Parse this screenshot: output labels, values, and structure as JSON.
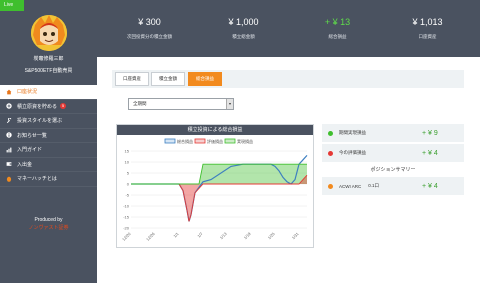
{
  "live_badge": "Live",
  "user": {
    "name": "炭竈修羅三郎",
    "subtitle": "S&P500ETF自動売買"
  },
  "nav": [
    {
      "label": "口座状況",
      "icon": "home-icon"
    },
    {
      "label": "積立原資を貯める",
      "icon": "plus-icon",
      "badge": "5"
    },
    {
      "label": "投資スタイルを選ぶ",
      "icon": "wrench-icon"
    },
    {
      "label": "お知らせ一覧",
      "icon": "info-icon"
    },
    {
      "label": "入門ガイド",
      "icon": "chart-icon"
    },
    {
      "label": "入出金",
      "icon": "wallet-icon"
    },
    {
      "label": "マネーハッチとは",
      "icon": "egg-icon"
    }
  ],
  "footer": {
    "produced": "Produced by",
    "brand": "ノンヴァスト証券"
  },
  "stats": [
    {
      "value": "¥ 300",
      "label": "次回投資分の積立金額",
      "color": "white"
    },
    {
      "value": "¥ 1,000",
      "label": "積立総金額",
      "color": "white"
    },
    {
      "value": "+ ¥ 13",
      "label": "総合損益",
      "color": "green"
    },
    {
      "value": "¥ 1,013",
      "label": "口座資産",
      "color": "white"
    }
  ],
  "tabs": [
    {
      "label": "口座資産",
      "active": false
    },
    {
      "label": "積立金額",
      "active": false
    },
    {
      "label": "総合損益",
      "active": true
    }
  ],
  "period_select": {
    "value": "全期間"
  },
  "chart": {
    "header": "積立投資による総合損益",
    "legend": [
      "総合損益",
      "評価損益",
      "実現損益"
    ]
  },
  "summary": {
    "rows": [
      {
        "label": "期間実現損益",
        "amount": "+ ¥ 9",
        "color": "#3fbf2e"
      },
      {
        "label": "今の評価損益",
        "amount": "+ ¥ 4",
        "color": "#e53935"
      }
    ],
    "positions_title": "ポジションサマリー",
    "positions": [
      {
        "name": "ACWI ARC",
        "qty": "0.1口",
        "amount": "+ ¥ 4",
        "color": "#f28a1e"
      }
    ]
  },
  "chart_data": {
    "type": "line",
    "title": "積立投資による総合損益",
    "x_ticks": [
      "12/20",
      "12/26",
      "1/1",
      "1/7",
      "1/13",
      "1/19",
      "1/25",
      "1/31"
    ],
    "ylim": [
      -20,
      15
    ],
    "y_ticks": [
      15,
      10,
      5,
      0,
      -5,
      -10,
      -15,
      -20
    ],
    "series": [
      {
        "name": "総合損益",
        "color": "#3d7fc0",
        "x": [
          0,
          5,
          10,
          12,
          13,
          14,
          14.5,
          15,
          16,
          18,
          20,
          25,
          28,
          30,
          31,
          32,
          33,
          34,
          35,
          36,
          37,
          38,
          39,
          40,
          41,
          42,
          43,
          44
        ],
        "y": [
          0,
          0,
          0,
          0,
          -3,
          -12,
          -17,
          -14,
          -4,
          1,
          2,
          8,
          9,
          9,
          9,
          9,
          9,
          9,
          9,
          8,
          6,
          3,
          1,
          0,
          2,
          9,
          11,
          13
        ]
      },
      {
        "name": "評価損益",
        "color": "#e53935",
        "x": [
          0,
          5,
          10,
          12,
          13,
          14,
          14.5,
          15,
          16,
          18,
          20,
          25,
          30,
          35,
          40,
          42,
          43,
          44
        ],
        "y": [
          0,
          0,
          0,
          0,
          -3,
          -12,
          -17,
          -14,
          -4,
          0,
          0,
          0,
          0,
          0,
          0,
          0,
          2,
          4
        ]
      },
      {
        "name": "実現損益",
        "color": "#3fbf2e",
        "x": [
          0,
          5,
          10,
          15,
          17,
          18,
          20,
          25,
          30,
          35,
          40,
          44
        ],
        "y": [
          0,
          0,
          0,
          0,
          0,
          9,
          9,
          9,
          9,
          9,
          9,
          9
        ]
      }
    ]
  }
}
